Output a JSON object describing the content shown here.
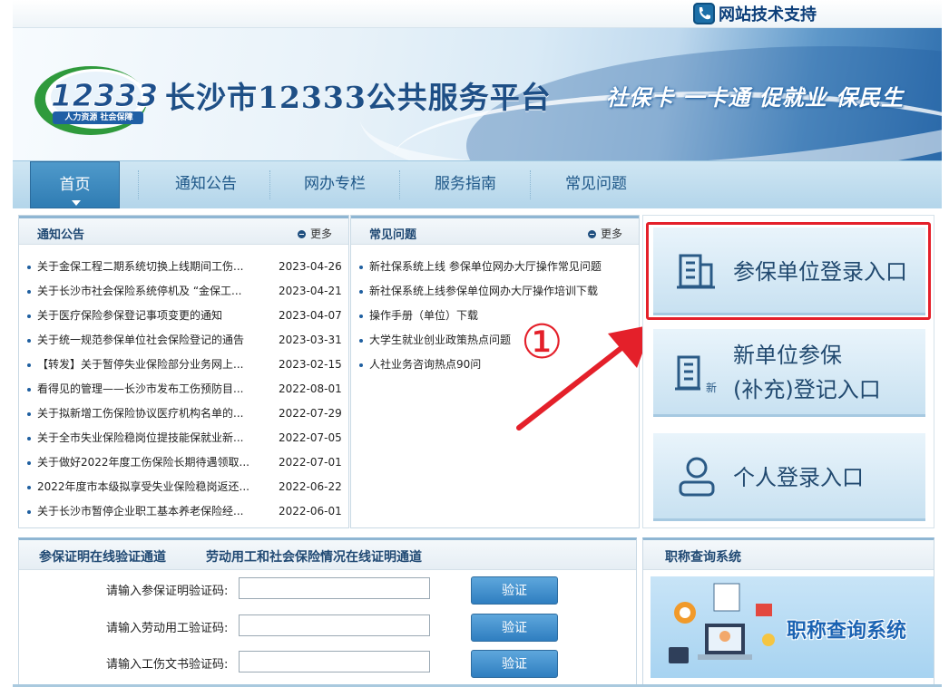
{
  "support": {
    "label": "网站技术支持",
    "icon": "phone-icon"
  },
  "header": {
    "logo_number": "12333",
    "logo_sub": "人力资源 社会保障",
    "site_title": "长沙市12333公共服务平台",
    "slogan": "社保卡 一卡通 促就业 保民生"
  },
  "nav": {
    "items": [
      {
        "label": "首页",
        "active": true
      },
      {
        "label": "通知公告"
      },
      {
        "label": "网办专栏"
      },
      {
        "label": "服务指南"
      },
      {
        "label": "常见问题"
      }
    ]
  },
  "notices": {
    "title": "通知公告",
    "more": "更多",
    "items": [
      {
        "title": "关于金保工程二期系统切换上线期间工伤...",
        "date": "2023-04-26"
      },
      {
        "title": "关于长沙市社会保险系统停机及 “金保工...",
        "date": "2023-04-21"
      },
      {
        "title": "关于医疗保险参保登记事项变更的通知",
        "date": "2023-04-07"
      },
      {
        "title": "关于统一规范参保单位社会保险登记的通告",
        "date": "2023-03-31"
      },
      {
        "title": "【转发】关于暂停失业保险部分业务网上...",
        "date": "2023-02-15"
      },
      {
        "title": "看得见的管理——长沙市发布工伤预防目...",
        "date": "2022-08-01"
      },
      {
        "title": "关于拟新增工伤保险协议医疗机构名单的...",
        "date": "2022-07-29"
      },
      {
        "title": "关于全市失业保险稳岗位提技能保就业新...",
        "date": "2022-07-05"
      },
      {
        "title": "关于做好2022年度工伤保险长期待遇领取...",
        "date": "2022-07-01"
      },
      {
        "title": "2022年度市本级拟享受失业保险稳岗返还...",
        "date": "2022-06-22"
      },
      {
        "title": "关于长沙市暂停企业职工基本养老保险经...",
        "date": "2022-06-01"
      }
    ]
  },
  "faq": {
    "title": "常见问题",
    "more": "更多",
    "items": [
      "新社保系统上线 参保单位网办大厅操作常见问题",
      "新社保系统上线参保单位网办大厅操作培训下载",
      "操作手册（单位）下载",
      "大学生就业创业政策热点问题",
      "人社业务咨询热点90问"
    ]
  },
  "annotation": {
    "number": "①",
    "color": "#e4202a"
  },
  "login": {
    "unit": "参保单位登录入口",
    "new_unit_line1": "新单位参保",
    "new_unit_line2": "(补充)登记入口",
    "new_badge": "新",
    "personal": "个人登录入口"
  },
  "verify": {
    "tab1": "参保证明在线验证通道",
    "tab2": "劳动用工和社会保险情况在线证明通道",
    "rows": [
      {
        "label": "请输入参保证明验证码:",
        "value": "",
        "button": "验证"
      },
      {
        "label": "请输入劳动用工验证码:",
        "value": "",
        "button": "验证"
      },
      {
        "label": "请输入工伤文书验证码:",
        "value": "",
        "button": "验证"
      }
    ]
  },
  "title_query": {
    "title": "职称查询系统",
    "banner_text": "职称查询系统"
  },
  "colors": {
    "brand_blue": "#1e4f86",
    "nav_active": "#2f7cb3",
    "highlight_red": "#e4202a"
  }
}
